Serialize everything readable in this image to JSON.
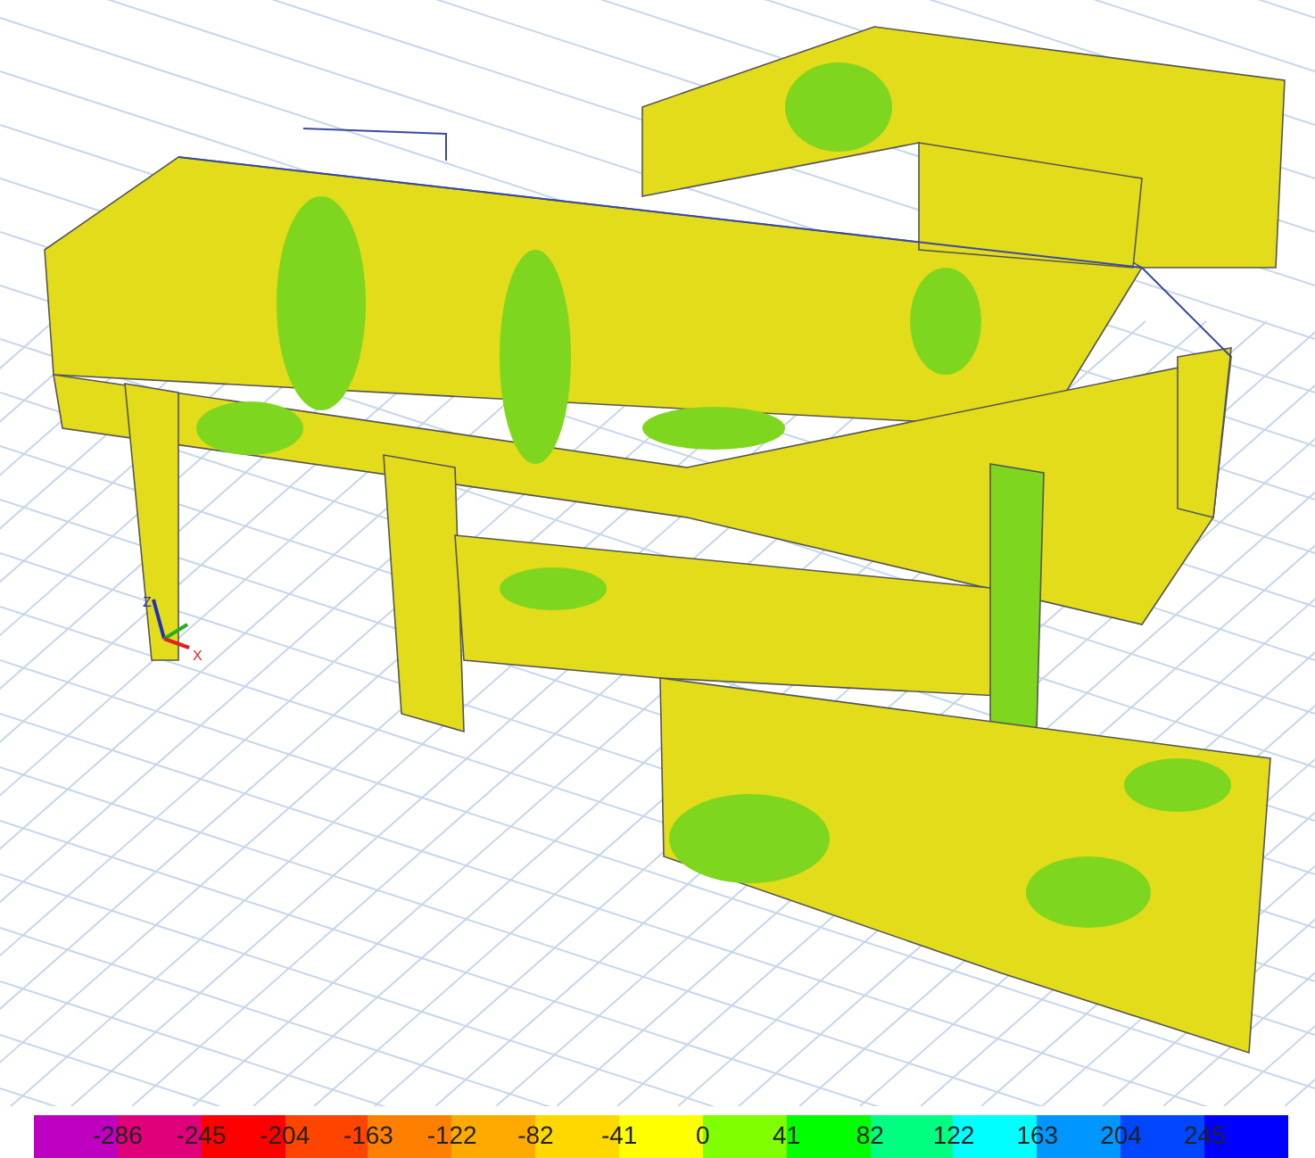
{
  "axes": {
    "z_label": "Z",
    "x_label": "X"
  },
  "legend": {
    "segments": [
      {
        "color": "#c000c0"
      },
      {
        "color": "#e0007a"
      },
      {
        "color": "#ff0000"
      },
      {
        "color": "#ff4400"
      },
      {
        "color": "#ff8000"
      },
      {
        "color": "#ffaa00"
      },
      {
        "color": "#ffd800"
      },
      {
        "color": "#ffff00"
      },
      {
        "color": "#80ff00"
      },
      {
        "color": "#00ff00"
      },
      {
        "color": "#00ff80"
      },
      {
        "color": "#00ffff"
      },
      {
        "color": "#0096ff"
      },
      {
        "color": "#0046ff"
      },
      {
        "color": "#0000ff"
      }
    ],
    "labels": [
      "-286",
      "-245",
      "-204",
      "-163",
      "-122",
      "-82",
      "-41",
      "0",
      "41",
      "82",
      "122",
      "163",
      "204",
      "245"
    ]
  }
}
